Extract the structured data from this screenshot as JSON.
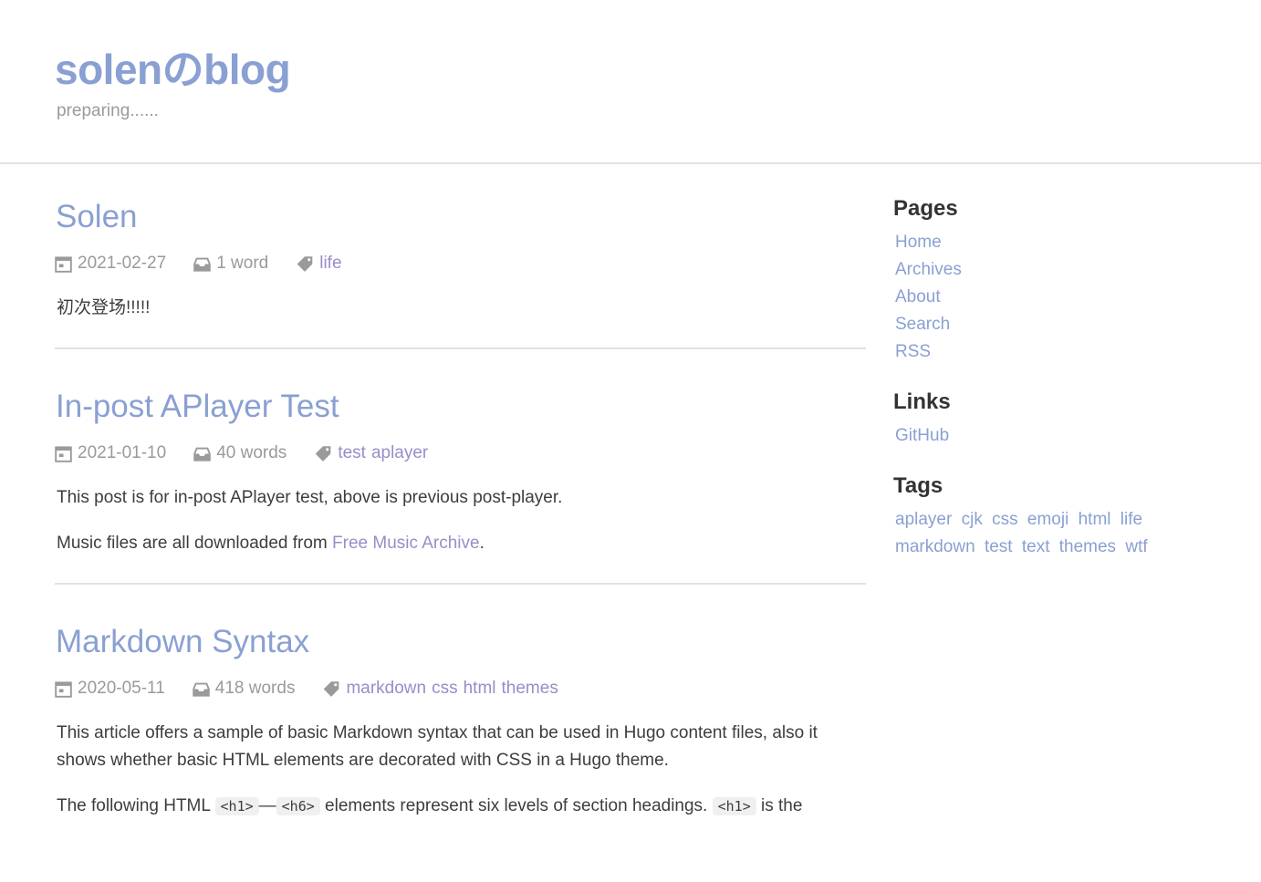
{
  "site": {
    "title": "solenのblog",
    "subtitle": "preparing......"
  },
  "posts": [
    {
      "title": "Solen",
      "date": "2021-02-27",
      "words": "1 word",
      "tags": [
        "life"
      ],
      "excerpt": [
        "初次登场!!!!!"
      ]
    },
    {
      "title": "In-post APlayer Test",
      "date": "2021-01-10",
      "words": "40 words",
      "tags": [
        "test",
        "aplayer"
      ],
      "excerpt_p1": "This post is for in-post APlayer test, above is previous post-player.",
      "excerpt_p2_prefix": "Music files are all downloaded from ",
      "excerpt_p2_link": "Free Music Archive",
      "excerpt_p2_suffix": "."
    },
    {
      "title": "Markdown Syntax",
      "date": "2020-05-11",
      "words": "418 words",
      "tags": [
        "markdown",
        "css",
        "html",
        "themes"
      ],
      "excerpt_p1": "This article offers a sample of basic Markdown syntax that can be used in Hugo content files, also it shows whether basic HTML elements are decorated with CSS in a Hugo theme.",
      "excerpt_p2": {
        "t1": "The following HTML ",
        "c1": "<h1>",
        "t2": "—",
        "c2": "<h6>",
        "t3": " elements represent six levels of section headings. ",
        "c3": "<h1>",
        "t4": " is the"
      }
    }
  ],
  "sidebar": {
    "pages_heading": "Pages",
    "pages": [
      "Home",
      "Archives",
      "About",
      "Search",
      "RSS"
    ],
    "links_heading": "Links",
    "links": [
      "GitHub"
    ],
    "tags_heading": "Tags",
    "tags": [
      "aplayer",
      "cjk",
      "css",
      "emoji",
      "html",
      "life",
      "markdown",
      "test",
      "text",
      "themes",
      "wtf"
    ]
  },
  "colors": {
    "accent": "#8aa0d3",
    "tag": "#9a8cc8",
    "meta": "#9a9a9a"
  },
  "icons": {
    "date": "calendar-icon",
    "words": "inbox-icon",
    "tags": "tag-icon"
  }
}
